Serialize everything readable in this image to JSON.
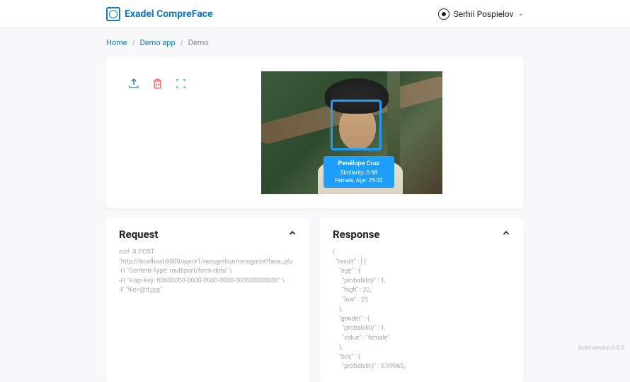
{
  "header": {
    "brand": "Exadel CompreFace",
    "user_name": "Serhii Pospielov"
  },
  "breadcrumb": {
    "home": "Home",
    "app": "Demo app",
    "current": "Demo"
  },
  "face": {
    "name": "Penélope Cruz",
    "similarity": "Similarity: 0.98",
    "gender_age": "Female, Age: 25-32"
  },
  "request": {
    "title": "Request",
    "body": "curl -X POST \"http://localhost:8000/api/v1/recognition/recognize?face_plu\n-H \"Content-Type: multipart/form-data\" \\\n-H \"x-api-key: 00000000-0000-0000-0000-000000000002\" \\\n-F \"file=@tt.jpg\""
  },
  "response": {
    "title": "Response",
    "body": "{\n  \"result\" : [ {\n    \"age\" : {\n      \"probability\" : 1,\n      \"high\" : 32,\n      \"low\" : 25\n    },\n    \"gender\" : {\n      \"probability\" : 1,\n      \"value\" : \"female\"\n    },\n    \"box\" : {\n      \"probability\" : 0.99965,"
  },
  "footer": {
    "version": "build version 0.6.0"
  }
}
